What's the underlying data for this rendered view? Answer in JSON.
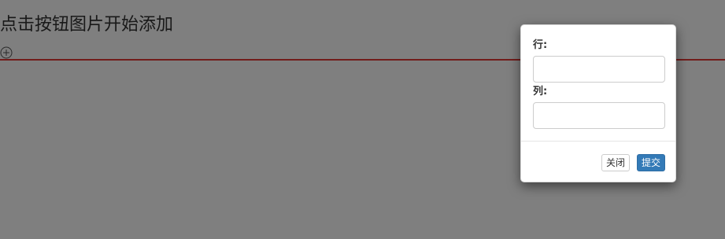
{
  "page": {
    "title": "点击按钮图片开始添加",
    "add_icon": "plus-circle-icon"
  },
  "colors": {
    "divider": "#e53935",
    "primary_button": "#337ab7",
    "overlay": "rgba(0,0,0,0.5)"
  },
  "modal": {
    "row_label": "行:",
    "row_value": "",
    "col_label": "列:",
    "col_value": "",
    "close_label": "关闭",
    "submit_label": "提交"
  }
}
